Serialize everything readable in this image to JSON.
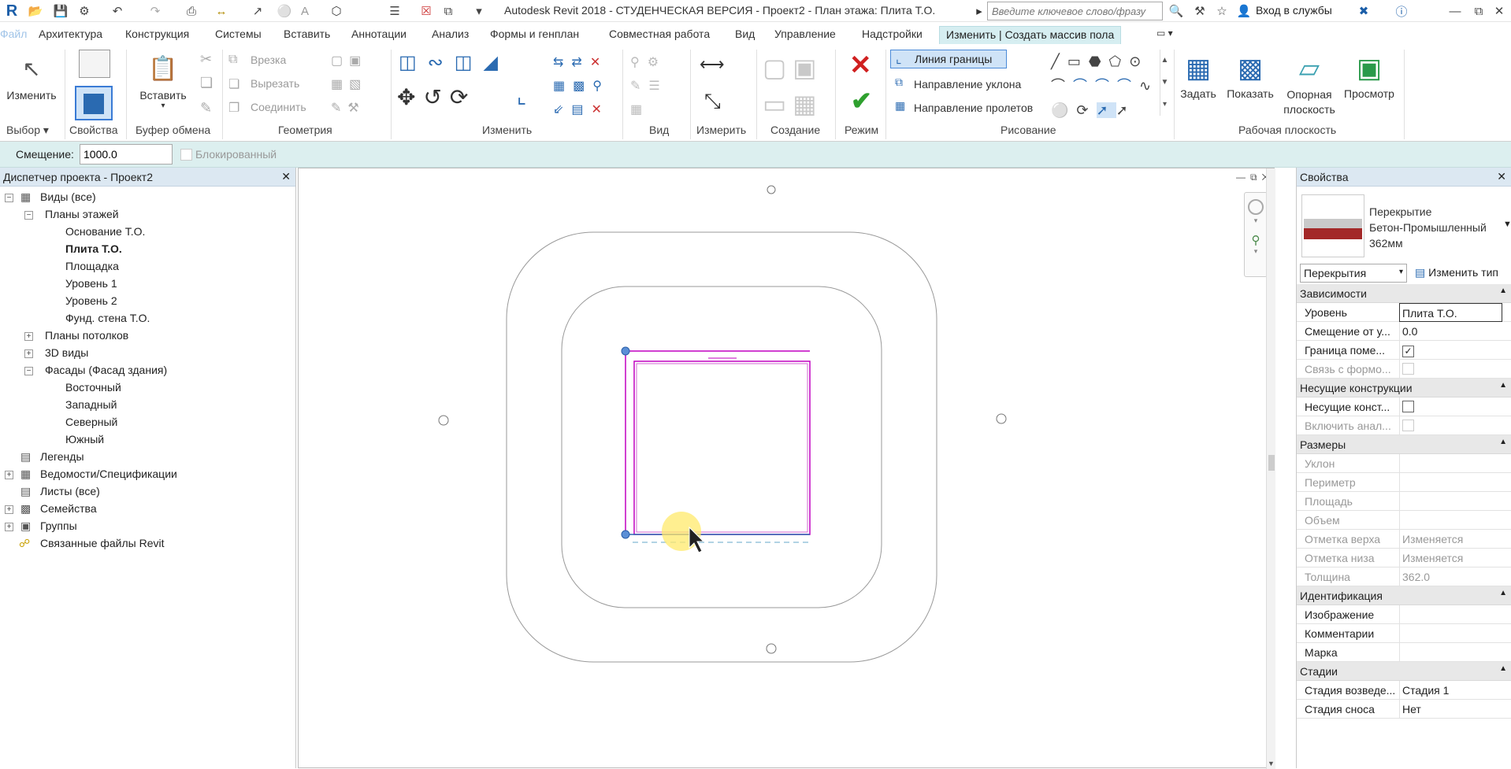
{
  "titlebar": {
    "title": "Autodesk Revit 2018 - СТУДЕНЧЕСКАЯ ВЕРСИЯ -     Проект2 - План этажа: Плита Т.О.",
    "search_placeholder": "Введите ключевое слово/фразу",
    "signin_label": "Вход в службы"
  },
  "tabs": [
    "Файл",
    "Архитектура",
    "Конструкция",
    "Системы",
    "Вставить",
    "Аннотации",
    "Анализ",
    "Формы и генплан",
    "Совместная работа",
    "Вид",
    "Управление",
    "Надстройки",
    "Изменить | Создать массив пола"
  ],
  "ribbon": {
    "select": {
      "modify_label": "Изменить",
      "panel_label": "Выбор"
    },
    "properties": {
      "panel_label": "Свойства"
    },
    "clipboard": {
      "paste_label": "Вставить",
      "panel_label": "Буфер обмена"
    },
    "geometry": {
      "cut_label": "Врезка",
      "cutout_label": "Вырезать",
      "join_label": "Соединить",
      "panel_label": "Геометрия"
    },
    "modify": {
      "panel_label": "Изменить"
    },
    "view": {
      "panel_label": "Вид"
    },
    "measure": {
      "panel_label": "Измерить"
    },
    "create": {
      "panel_label": "Создание"
    },
    "mode": {
      "panel_label": "Режим"
    },
    "draw": {
      "boundary_line": "Линия границы",
      "slope_arrow": "Направление уклона",
      "span_direction": "Направление пролетов",
      "panel_label": "Рисование"
    },
    "workplane": {
      "set_label": "Задать",
      "show_label": "Показать",
      "ref_plane_label": "Опорная\nплоскость",
      "viewer_label": "Просмотр",
      "panel_label": "Рабочая плоскость"
    }
  },
  "optionsbar": {
    "offset_label": "Смещение:",
    "offset_value": "1000.0",
    "locked_label": "Блокированный"
  },
  "browser": {
    "title": "Диспетчер проекта - Проект2",
    "items": [
      {
        "label": "Виды (все)"
      },
      {
        "label": "Планы этажей"
      },
      {
        "label": "Основание Т.О."
      },
      {
        "label": "Плита Т.О."
      },
      {
        "label": "Площадка"
      },
      {
        "label": "Уровень 1"
      },
      {
        "label": "Уровень 2"
      },
      {
        "label": "Фунд. стена Т.О."
      },
      {
        "label": "Планы потолков"
      },
      {
        "label": "3D виды"
      },
      {
        "label": "Фасады (Фасад здания)"
      },
      {
        "label": "Восточный"
      },
      {
        "label": "Западный"
      },
      {
        "label": "Северный"
      },
      {
        "label": "Южный"
      },
      {
        "label": "Легенды"
      },
      {
        "label": "Ведомости/Спецификации"
      },
      {
        "label": "Листы (все)"
      },
      {
        "label": "Семейства"
      },
      {
        "label": "Группы"
      },
      {
        "label": "Связанные файлы Revit"
      }
    ]
  },
  "properties": {
    "title": "Свойства",
    "type_line1": "Перекрытие",
    "type_line2": "Бетон-Промышленный",
    "type_line3": "362мм",
    "category": "Перекрытия",
    "edit_type": "Изменить тип",
    "groups": {
      "constraints": "Зависимости",
      "structural": "Несущие конструкции",
      "dimensions": "Размеры",
      "identity": "Идентификация",
      "phasing": "Стадии"
    },
    "rows": {
      "level": {
        "label": "Уровень",
        "value": "Плита Т.О."
      },
      "offset": {
        "label": "Смещение от у...",
        "value": "0.0"
      },
      "room_bounding": {
        "label": "Граница поме...",
        "value": "✓"
      },
      "mass_link": {
        "label": "Связь с формо...",
        "value": ""
      },
      "structural": {
        "label": "Несущие конст...",
        "value": ""
      },
      "analytic": {
        "label": "Включить анал...",
        "value": ""
      },
      "slope": {
        "label": "Уклон",
        "value": ""
      },
      "perimeter": {
        "label": "Периметр",
        "value": ""
      },
      "area": {
        "label": "Площадь",
        "value": ""
      },
      "volume": {
        "label": "Объем",
        "value": ""
      },
      "top_elev": {
        "label": "Отметка верха",
        "value": "Изменяется"
      },
      "bottom_elev": {
        "label": "Отметка низа",
        "value": "Изменяется"
      },
      "thickness": {
        "label": "Толщина",
        "value": "362.0"
      },
      "image": {
        "label": "Изображение",
        "value": ""
      },
      "comments": {
        "label": "Комментарии",
        "value": ""
      },
      "mark": {
        "label": "Марка",
        "value": ""
      },
      "phase_created": {
        "label": "Стадия возведе...",
        "value": "Стадия 1"
      },
      "phase_demolished": {
        "label": "Стадия сноса",
        "value": "Нет"
      }
    }
  },
  "colors": {
    "accent": "#c000c0",
    "teal_bg": "#dcefef",
    "ribbon_tab_active": "#d6eef1"
  }
}
